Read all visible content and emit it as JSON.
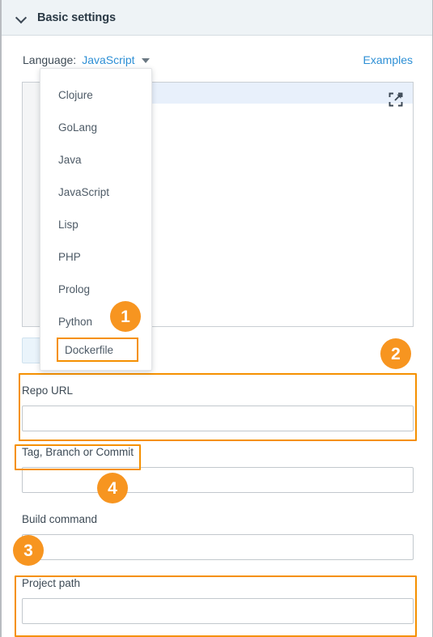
{
  "panel": {
    "title": "Basic settings",
    "collapse_icon": "chevron-down-icon"
  },
  "language_row": {
    "label": "Language:",
    "selected": "JavaScript",
    "caret_icon": "caret-down-icon",
    "examples_link": "Examples"
  },
  "editor": {
    "content": "",
    "expand_icon": "expand-fullscreen-icon"
  },
  "action_button": {
    "label": ""
  },
  "dropdown": {
    "options": [
      {
        "label": "Clojure",
        "highlighted": false
      },
      {
        "label": "GoLang",
        "highlighted": false
      },
      {
        "label": "Java",
        "highlighted": false
      },
      {
        "label": "JavaScript",
        "highlighted": false
      },
      {
        "label": "Lisp",
        "highlighted": false
      },
      {
        "label": "PHP",
        "highlighted": false
      },
      {
        "label": "Prolog",
        "highlighted": false
      },
      {
        "label": "Python",
        "highlighted": false
      },
      {
        "label": "Dockerfile",
        "highlighted": true
      }
    ]
  },
  "fields": [
    {
      "label": "Repo URL",
      "value": "",
      "placeholder": ""
    },
    {
      "label": "Tag, Branch or Commit",
      "value": "",
      "placeholder": ""
    },
    {
      "label": "Build command",
      "value": "",
      "placeholder": ""
    },
    {
      "label": "Project path",
      "value": "",
      "placeholder": ""
    }
  ],
  "badges": [
    {
      "number": "1"
    },
    {
      "number": "2"
    },
    {
      "number": "3"
    },
    {
      "number": "4"
    }
  ],
  "colors": {
    "accent_orange": "#f59000",
    "badge_orange": "#f79520",
    "link_blue": "#2d8fd5",
    "header_bg": "#eef3f6",
    "active_line": "#e8f0fb"
  }
}
